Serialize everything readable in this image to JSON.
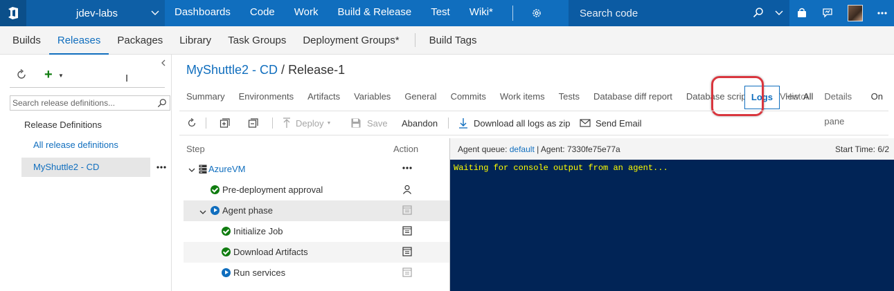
{
  "project": {
    "name": "jdev-labs"
  },
  "topnav": [
    "Dashboards",
    "Code",
    "Work",
    "Build & Release",
    "Test",
    "Wiki*"
  ],
  "search": {
    "placeholder": "Search code"
  },
  "hubtabs": {
    "primary": [
      "Builds",
      "Releases",
      "Packages",
      "Library",
      "Task Groups",
      "Deployment Groups*"
    ],
    "secondary": "Build Tags",
    "active": "Releases"
  },
  "leftpane": {
    "search_placeholder": "Search release definitions...",
    "tree_header": "Release Definitions",
    "all_link": "All release definitions",
    "selected": "MyShuttle2 - CD"
  },
  "breadcrumb": {
    "definition": "MyShuttle2 - CD",
    "separator": "/",
    "release": "Release-1"
  },
  "pivot_tabs": [
    "Summary",
    "Environments",
    "Artifacts",
    "Variables",
    "General",
    "Commits",
    "Work items",
    "Tests",
    "Database diff report",
    "Database script",
    "Logs",
    "History"
  ],
  "active_tab": "Logs",
  "view_options": {
    "view_label": "View",
    "view_value": "All",
    "details_label": "Details pane",
    "details_value": "On"
  },
  "toolbar": {
    "deploy": "Deploy",
    "save": "Save",
    "abandon": "Abandon",
    "download": "Download all logs as zip",
    "email": "Send Email"
  },
  "steps": {
    "col_step": "Step",
    "col_action": "Action",
    "environment": "AzureVM",
    "items": [
      {
        "label": "Pre-deployment approval",
        "status": "succeeded"
      },
      {
        "label": "Agent phase",
        "status": "in-progress"
      },
      {
        "label": "Initialize Job",
        "status": "succeeded"
      },
      {
        "label": "Download Artifacts",
        "status": "succeeded"
      },
      {
        "label": "Run services",
        "status": "in-progress"
      }
    ]
  },
  "log": {
    "queue_label": "Agent queue:",
    "queue_value": "default",
    "agent_label": "| Agent:",
    "agent_value": "7330fe75e77a",
    "start_label": "Start Time:",
    "start_value": "6/2",
    "console_text": "Waiting for console output from an agent..."
  },
  "colors": {
    "accent": "#106ebe",
    "topbar": "#106ebe",
    "success": "#107c10",
    "console_bg": "#012456",
    "console_text": "#ffff00",
    "highlight": "#d9363e"
  }
}
